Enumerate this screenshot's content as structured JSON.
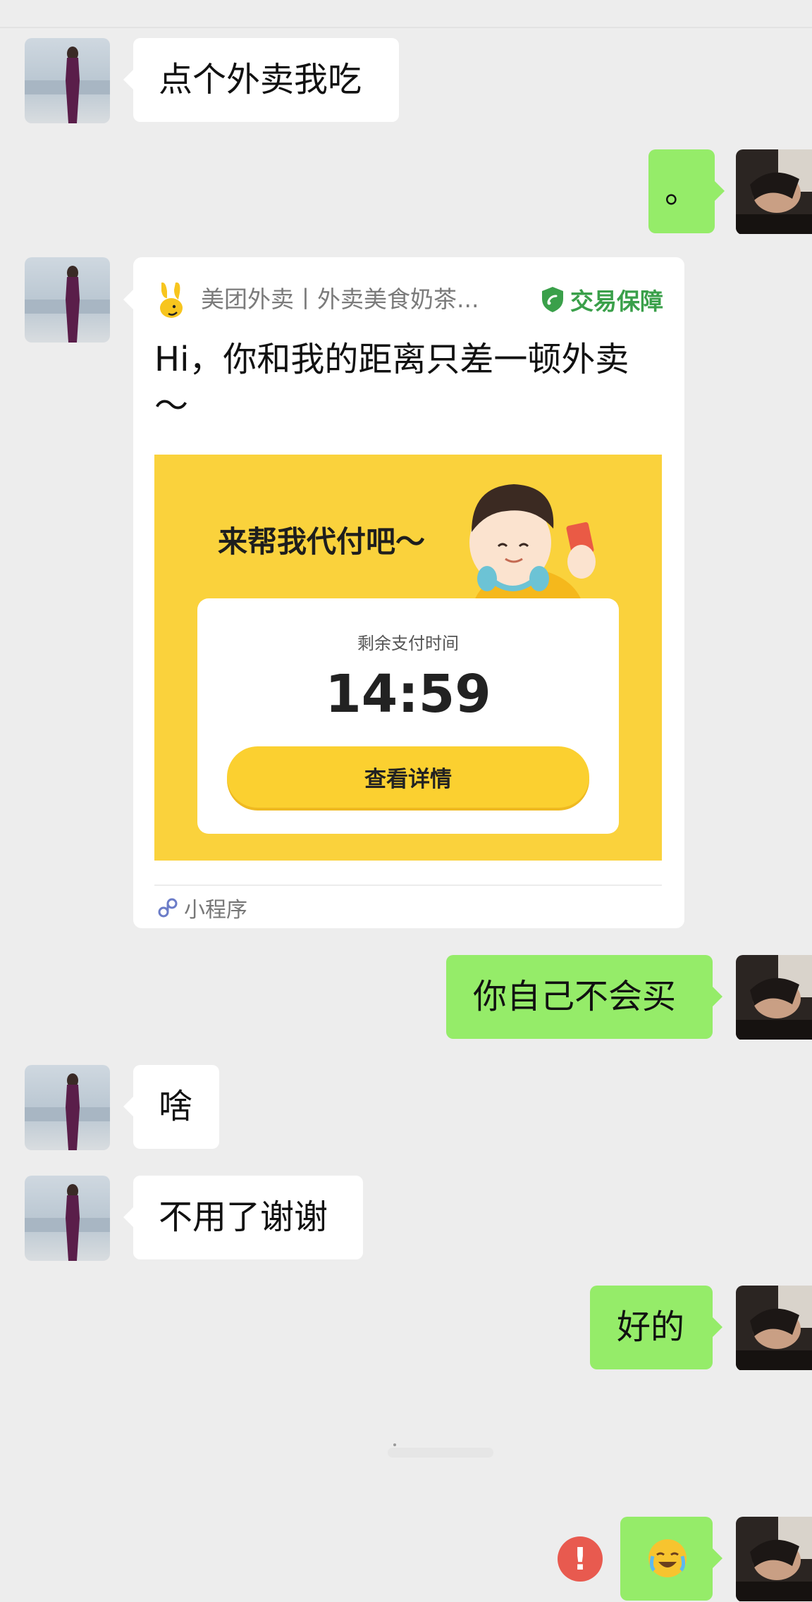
{
  "messages": [
    {
      "side": "peer",
      "text": "点个外卖我吃"
    },
    {
      "side": "me",
      "text": "。"
    },
    {
      "side": "peer",
      "type": "mini_program_card",
      "app_name": "美团外卖丨外卖美食奶茶...",
      "badge": "交易保障",
      "title": "Hi，你和我的距离只差一顿外卖～",
      "banner_slogan": "来帮我代付吧～",
      "countdown_label": "剩余支付时间",
      "countdown": "14:59",
      "button_label": "查看详情",
      "footer": "小程序"
    },
    {
      "side": "me",
      "text": "你自己不会买"
    },
    {
      "side": "peer",
      "text": "啥"
    },
    {
      "side": "peer",
      "text": "不用了谢谢"
    },
    {
      "side": "me",
      "text": "好的"
    },
    {
      "side": "me",
      "type": "emoji",
      "emoji": "😭",
      "status": "failed",
      "status_icon": "!"
    }
  ],
  "colors": {
    "background": "#ededed",
    "peer_bubble": "#ffffff",
    "my_bubble": "#95ec69",
    "guarantee_green": "#3aa04a",
    "promo_yellow": "#fad23c",
    "error_red": "#e85a4f"
  }
}
